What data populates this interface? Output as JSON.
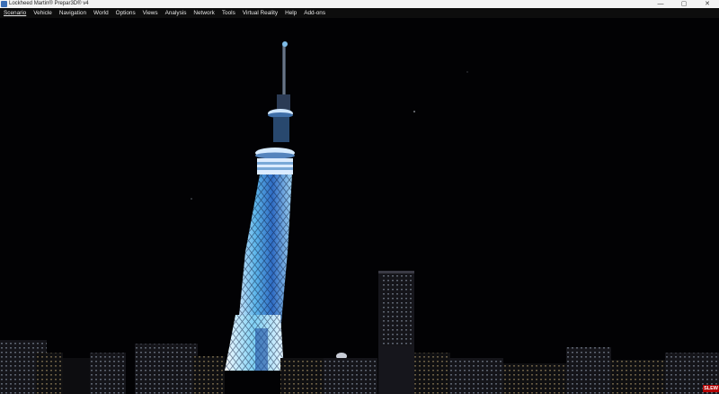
{
  "window": {
    "title": "Lockheed Martin® Prepar3D® v4",
    "icon": "prepar3d-app-icon",
    "controls": {
      "minimize": "—",
      "maximize": "▢",
      "close": "✕"
    }
  },
  "menubar": {
    "items": [
      {
        "label": "Scenario"
      },
      {
        "label": "Vehicle"
      },
      {
        "label": "Navigation"
      },
      {
        "label": "World"
      },
      {
        "label": "Options"
      },
      {
        "label": "Views"
      },
      {
        "label": "Analysis"
      },
      {
        "label": "Network"
      },
      {
        "label": "Tools"
      },
      {
        "label": "Virtual Reality"
      },
      {
        "label": "Help"
      },
      {
        "label": "Add-ons"
      }
    ]
  },
  "scene": {
    "description_icon": "night-city-tower-scene",
    "sky_color": "#020204",
    "tower_light_color": "#4aa8e0",
    "tower_white_color": "#e8f4ff"
  },
  "status": {
    "slew_badge": "SLEW",
    "slew_color": "#b30000"
  }
}
